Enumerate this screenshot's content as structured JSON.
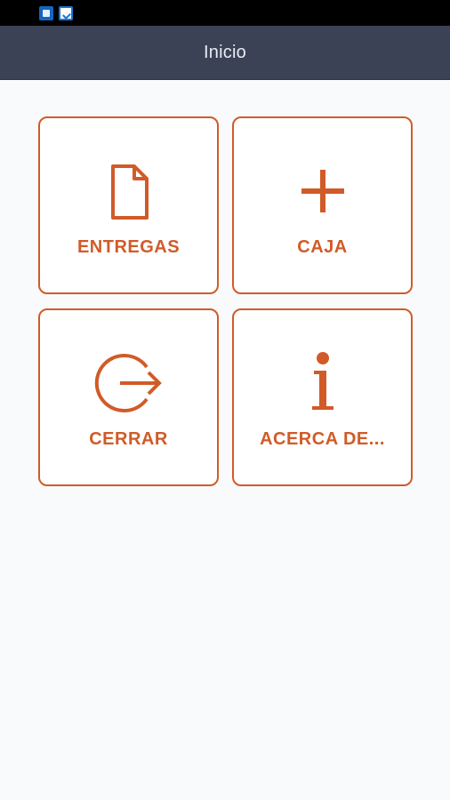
{
  "header": {
    "title": "Inicio"
  },
  "menu": {
    "items": [
      {
        "label": "ENTREGAS",
        "icon": "document-icon"
      },
      {
        "label": "CAJA",
        "icon": "plus-icon"
      },
      {
        "label": "CERRAR",
        "icon": "logout-icon"
      },
      {
        "label": "ACERCA DE...",
        "icon": "info-icon"
      }
    ]
  },
  "colors": {
    "accent": "#d15b28",
    "app_bar": "#3b4255",
    "background": "#f8fafc",
    "status_bar": "#000000"
  }
}
